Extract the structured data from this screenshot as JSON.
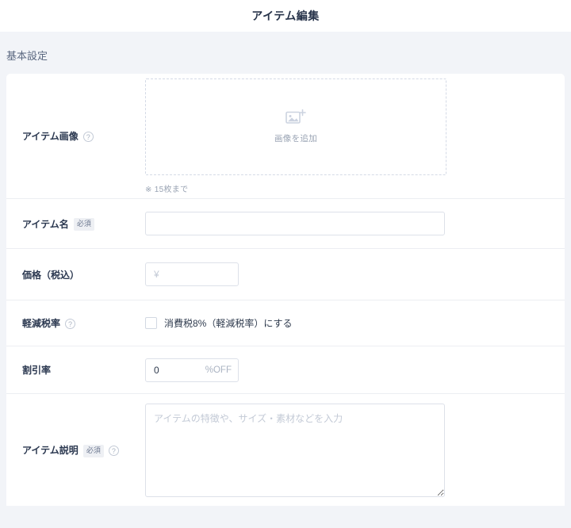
{
  "header": {
    "title": "アイテム編集"
  },
  "section": {
    "heading": "基本設定"
  },
  "form": {
    "image": {
      "label": "アイテム画像",
      "help_icon": "question-mark-circle-icon",
      "upload_icon": "add-image-icon",
      "upload_label": "画像を追加",
      "note": "※ 15枚まで"
    },
    "item_name": {
      "label": "アイテム名",
      "badge": "必須",
      "value": "",
      "placeholder": ""
    },
    "price": {
      "label": "価格（税込）",
      "value": "",
      "placeholder": "¥"
    },
    "reduced_tax": {
      "label": "軽減税率",
      "help_icon": "question-mark-circle-icon",
      "checkbox_label": "消費税8%（軽減税率）にする",
      "checked": false
    },
    "discount": {
      "label": "割引率",
      "value": "0",
      "suffix": "%OFF"
    },
    "description": {
      "label": "アイテム説明",
      "badge": "必須",
      "help_icon": "question-mark-circle-icon",
      "value": "",
      "placeholder": "アイテムの特徴や、サイズ・素材などを入力"
    }
  },
  "colors": {
    "page_background": "#f2f4f8",
    "card_background": "#ffffff",
    "title_text": "#27334a",
    "label_text": "#2b3850",
    "muted_text": "#9aa4b4",
    "border": "#dde1e9",
    "divider": "#eceef2",
    "badge_background": "#eef0f4"
  }
}
